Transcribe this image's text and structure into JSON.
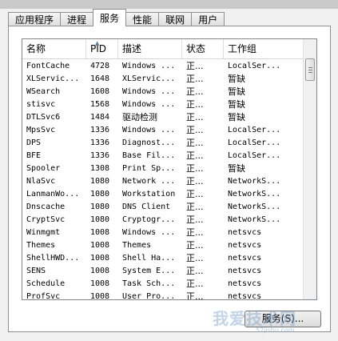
{
  "tabs": [
    {
      "label": "应用程序",
      "active": false
    },
    {
      "label": "进程",
      "active": false
    },
    {
      "label": "服务",
      "active": true
    },
    {
      "label": "性能",
      "active": false
    },
    {
      "label": "联网",
      "active": false
    },
    {
      "label": "用户",
      "active": false
    }
  ],
  "columns": [
    "名称",
    "PID",
    "描述",
    "状态",
    "工作组"
  ],
  "sort_indicator": "▲",
  "rows": [
    {
      "name": "FontCache",
      "pid": "4728",
      "desc": "Windows ...",
      "status": "正...",
      "group": "LocalSer..."
    },
    {
      "name": "XLServic...",
      "pid": "1648",
      "desc": "XLServic...",
      "status": "正...",
      "group": "暂缺"
    },
    {
      "name": "WSearch",
      "pid": "1608",
      "desc": "Windows ...",
      "status": "正...",
      "group": "暂缺"
    },
    {
      "name": "stisvc",
      "pid": "1568",
      "desc": "Windows ...",
      "status": "正...",
      "group": "暂缺"
    },
    {
      "name": "DTLSvc6",
      "pid": "1484",
      "desc": "驱动检测",
      "status": "正...",
      "group": "暂缺"
    },
    {
      "name": "MpsSvc",
      "pid": "1336",
      "desc": "Windows ...",
      "status": "正...",
      "group": "LocalSer..."
    },
    {
      "name": "DPS",
      "pid": "1336",
      "desc": "Diagnost...",
      "status": "正...",
      "group": "LocalSer..."
    },
    {
      "name": "BFE",
      "pid": "1336",
      "desc": "Base Fil...",
      "status": "正...",
      "group": "LocalSer..."
    },
    {
      "name": "Spooler",
      "pid": "1308",
      "desc": "Print Sp...",
      "status": "正...",
      "group": "暂缺"
    },
    {
      "name": "NlaSvc",
      "pid": "1080",
      "desc": "Network ...",
      "status": "正...",
      "group": "NetworkS..."
    },
    {
      "name": "LanmanWo...",
      "pid": "1080",
      "desc": "Workstation",
      "status": "正...",
      "group": "NetworkS..."
    },
    {
      "name": "Dnscache",
      "pid": "1080",
      "desc": "DNS Client",
      "status": "正...",
      "group": "NetworkS..."
    },
    {
      "name": "CryptSvc",
      "pid": "1080",
      "desc": "Cryptogr...",
      "status": "正...",
      "group": "NetworkS..."
    },
    {
      "name": "Winmgmt",
      "pid": "1008",
      "desc": "Windows ...",
      "status": "正...",
      "group": "netsvcs"
    },
    {
      "name": "Themes",
      "pid": "1008",
      "desc": "Themes",
      "status": "正...",
      "group": "netsvcs"
    },
    {
      "name": "ShellHWD...",
      "pid": "1008",
      "desc": "Shell Ha...",
      "status": "正...",
      "group": "netsvcs"
    },
    {
      "name": "SENS",
      "pid": "1008",
      "desc": "System E...",
      "status": "正...",
      "group": "netsvcs"
    },
    {
      "name": "Schedule",
      "pid": "1008",
      "desc": "Task Sch...",
      "status": "正...",
      "group": "netsvcs"
    },
    {
      "name": "ProfSvc",
      "pid": "1008",
      "desc": "User Pro...",
      "status": "正...",
      "group": "netsvcs"
    }
  ],
  "services_button_label": "服务(S)...",
  "watermark": {
    "text": "我爱技术网",
    "url": "52jishu.com"
  }
}
